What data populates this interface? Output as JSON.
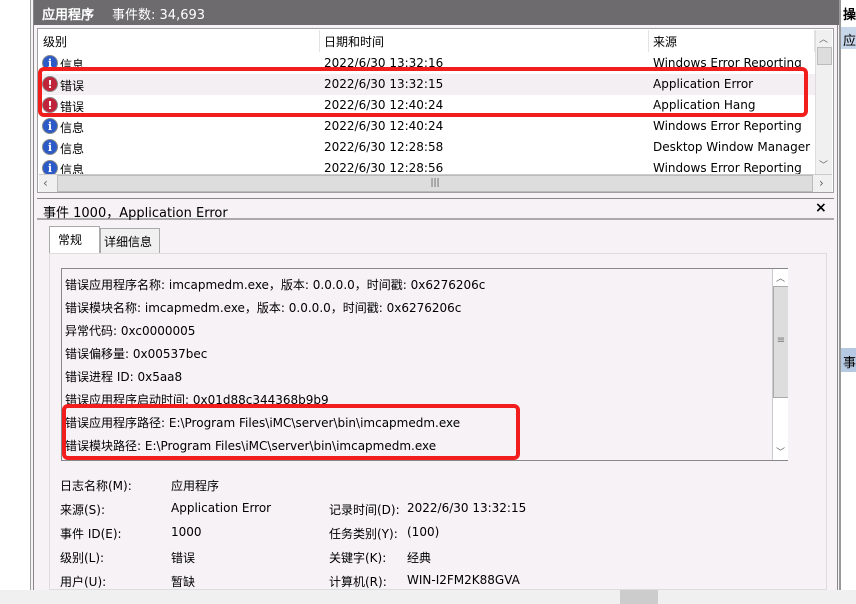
{
  "header": {
    "log_name": "应用程序",
    "event_count_label": "事件数: 34,693"
  },
  "list": {
    "columns": [
      "级别",
      "日期和时间",
      "来源"
    ],
    "rows": [
      {
        "icon": "info-icon",
        "level": "信息",
        "datetime": "2022/6/30 13:32:16",
        "source": "Windows Error Reporting"
      },
      {
        "icon": "error-icon",
        "level": "错误",
        "datetime": "2022/6/30 13:32:15",
        "source": "Application Error"
      },
      {
        "icon": "error-icon",
        "level": "错误",
        "datetime": "2022/6/30 12:40:24",
        "source": "Application Hang"
      },
      {
        "icon": "info-icon",
        "level": "信息",
        "datetime": "2022/6/30 12:40:24",
        "source": "Windows Error Reporting"
      },
      {
        "icon": "info-icon",
        "level": "信息",
        "datetime": "2022/6/30 12:28:58",
        "source": "Desktop Window Manager"
      },
      {
        "icon": "info-icon",
        "level": "信息",
        "datetime": "2022/6/30 12:28:56",
        "source": "Windows Error Reporting"
      }
    ]
  },
  "detail": {
    "title": "事件 1000，Application Error",
    "close": "×",
    "tabs": [
      "常规",
      "详细信息"
    ],
    "description": [
      "错误应用程序名称: imcapmedm.exe，版本: 0.0.0.0，时间戳: 0x6276206c",
      "错误模块名称: imcapmedm.exe，版本: 0.0.0.0，时间戳: 0x6276206c",
      "异常代码: 0xc0000005",
      "错误偏移量: 0x00537bec",
      "错误进程 ID: 0x5aa8",
      "错误应用程序启动时间: 0x01d88c344368b9b9",
      "错误应用程序路径: E:\\Program Files\\iMC\\server\\bin\\imcapmedm.exe",
      "错误模块路径: E:\\Program Files\\iMC\\server\\bin\\imcapmedm.exe"
    ],
    "fields": {
      "log_name_label": "日志名称(M):",
      "log_name": "应用程序",
      "source_label": "来源(S):",
      "source": "Application Error",
      "logged_label": "记录时间(D):",
      "logged": "2022/6/30 13:32:15",
      "event_id_label": "事件 ID(E):",
      "event_id": "1000",
      "task_label": "任务类别(Y):",
      "task": "(100)",
      "level_label": "级别(L):",
      "level": "错误",
      "keywords_label": "关键字(K):",
      "keywords": "经典",
      "user_label": "用户(U):",
      "user": "暂缺",
      "computer_label": "计算机(R):",
      "computer": "WIN-I2FM2K88GVA"
    }
  },
  "actions": {
    "header": "操",
    "selected_item": "应",
    "section2": "事"
  }
}
